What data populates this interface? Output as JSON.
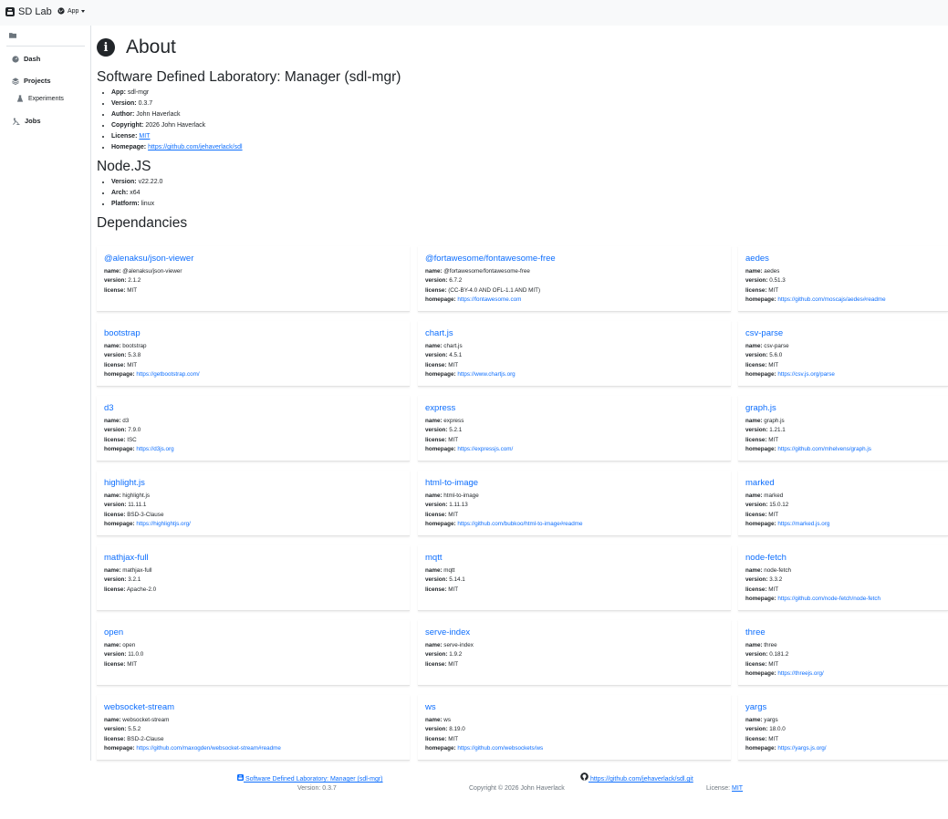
{
  "nav": {
    "brand": "SD Lab",
    "app_menu": "App"
  },
  "sidebar": {
    "items": [
      {
        "label": "Dash",
        "icon": "gauge-icon"
      },
      {
        "label": "Projects",
        "icon": "layers-icon"
      },
      {
        "label": "Experiments",
        "icon": "flask-icon"
      },
      {
        "label": "Jobs",
        "icon": "person-digging-icon"
      }
    ]
  },
  "page": {
    "title": "About",
    "app_section": {
      "heading": "Software Defined Laboratory: Manager (sdl-mgr)",
      "app_label": "App:",
      "app": "sdl-mgr",
      "version_label": "Version:",
      "version": "0.3.7",
      "author_label": "Author:",
      "author": "John Haverlack",
      "copyright_label": "Copyright:",
      "copyright": "2026 John Haverlack",
      "license_label": "License:",
      "license": "MIT",
      "homepage_label": "Homepage:",
      "homepage": "https://github.com/jehaverlack/sdl"
    },
    "node_section": {
      "heading": "Node.JS",
      "version_label": "Version:",
      "version": "v22.22.0",
      "arch_label": "Arch:",
      "arch": "x64",
      "platform_label": "Platform:",
      "platform": "linux"
    },
    "deps_heading": "Dependancies",
    "field_labels": {
      "name": "name:",
      "version": "version:",
      "license": "license:",
      "homepage": "homepage:"
    },
    "dependencies": [
      {
        "title": "@alenaksu/json-viewer",
        "name": "@alenaksu/json-viewer",
        "version": "2.1.2",
        "license": "MIT",
        "homepage": ""
      },
      {
        "title": "@fortawesome/fontawesome-free",
        "name": "@fortawesome/fontawesome-free",
        "version": "6.7.2",
        "license": "(CC-BY-4.0 AND OFL-1.1 AND MIT)",
        "homepage": "https://fontawesome.com"
      },
      {
        "title": "aedes",
        "name": "aedes",
        "version": "0.51.3",
        "license": "MIT",
        "homepage": "https://github.com/moscajs/aedes#readme"
      },
      {
        "title": "bootstrap",
        "name": "bootstrap",
        "version": "5.3.8",
        "license": "MIT",
        "homepage": "https://getbootstrap.com/"
      },
      {
        "title": "chart.js",
        "name": "chart.js",
        "version": "4.5.1",
        "license": "MIT",
        "homepage": "https://www.chartjs.org"
      },
      {
        "title": "csv-parse",
        "name": "csv-parse",
        "version": "5.6.0",
        "license": "MIT",
        "homepage": "https://csv.js.org/parse"
      },
      {
        "title": "d3",
        "name": "d3",
        "version": "7.9.0",
        "license": "ISC",
        "homepage": "https://d3js.org"
      },
      {
        "title": "express",
        "name": "express",
        "version": "5.2.1",
        "license": "MIT",
        "homepage": "https://expressjs.com/"
      },
      {
        "title": "graph.js",
        "name": "graph.js",
        "version": "1.21.1",
        "license": "MIT",
        "homepage": "https://github.com/mhelvens/graph.js"
      },
      {
        "title": "highlight.js",
        "name": "highlight.js",
        "version": "11.11.1",
        "license": "BSD-3-Clause",
        "homepage": "https://highlightjs.org/"
      },
      {
        "title": "html-to-image",
        "name": "html-to-image",
        "version": "1.11.13",
        "license": "MIT",
        "homepage": "https://github.com/bubkoo/html-to-image#readme"
      },
      {
        "title": "marked",
        "name": "marked",
        "version": "15.0.12",
        "license": "MIT",
        "homepage": "https://marked.js.org"
      },
      {
        "title": "mathjax-full",
        "name": "mathjax-full",
        "version": "3.2.1",
        "license": "Apache-2.0",
        "homepage": ""
      },
      {
        "title": "mqtt",
        "name": "mqtt",
        "version": "5.14.1",
        "license": "MIT",
        "homepage": ""
      },
      {
        "title": "node-fetch",
        "name": "node-fetch",
        "version": "3.3.2",
        "license": "MIT",
        "homepage": "https://github.com/node-fetch/node-fetch"
      },
      {
        "title": "open",
        "name": "open",
        "version": "11.0.0",
        "license": "MIT",
        "homepage": ""
      },
      {
        "title": "serve-index",
        "name": "serve-index",
        "version": "1.9.2",
        "license": "MIT",
        "homepage": ""
      },
      {
        "title": "three",
        "name": "three",
        "version": "0.181.2",
        "license": "MIT",
        "homepage": "https://threejs.org/"
      },
      {
        "title": "websocket-stream",
        "name": "websocket-stream",
        "version": "5.5.2",
        "license": "BSD-2-Clause",
        "homepage": "https://github.com/maxogden/websocket-stream#readme"
      },
      {
        "title": "ws",
        "name": "ws",
        "version": "8.19.0",
        "license": "MIT",
        "homepage": "https://github.com/websockets/ws"
      },
      {
        "title": "yargs",
        "name": "yargs",
        "version": "18.0.0",
        "license": "MIT",
        "homepage": "https://yargs.js.org/"
      }
    ]
  },
  "footer": {
    "app_link": "Software Defined Laboratory: Manager (sdl-mgr)",
    "version_text": "Version: 0.3.7",
    "copyright_text": "Copyright © 2026 John Haverlack",
    "repo_link": "https://github.com/jehaverlack/sdl.git",
    "license_label": "License:",
    "license_link": "MIT"
  },
  "colors": {
    "link": "#0d6efd",
    "text": "#212529",
    "navbar_bg": "#f8f9fa"
  }
}
